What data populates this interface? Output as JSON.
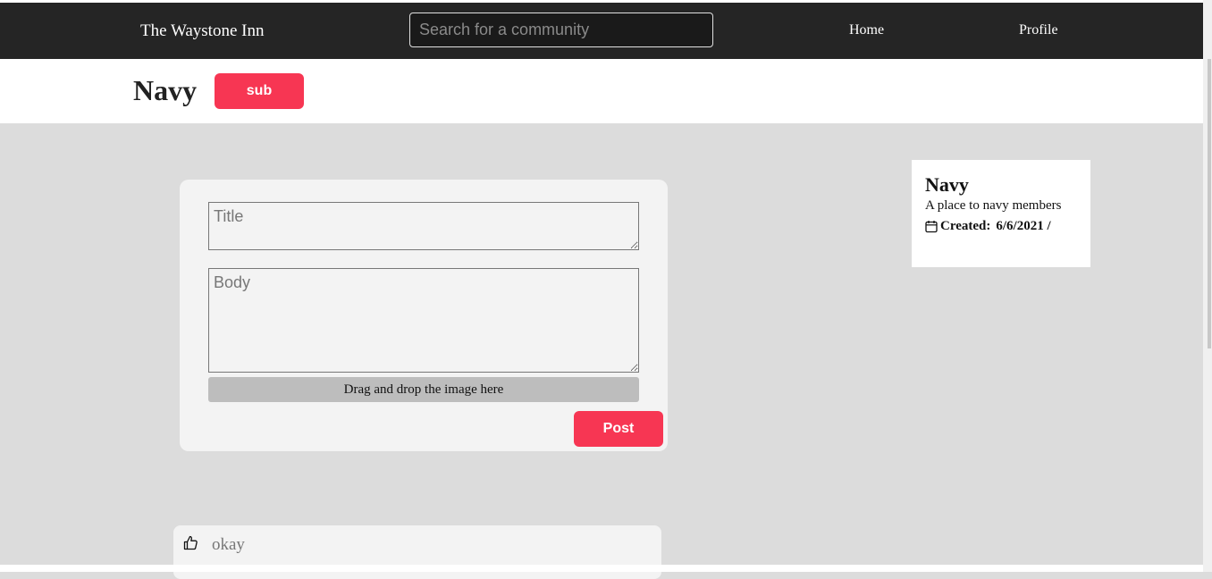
{
  "navbar": {
    "brand": "The Waystone Inn",
    "search_placeholder": "Search for a community",
    "links": [
      "Home",
      "Profile"
    ]
  },
  "community": {
    "title": "Navy",
    "subscribe_label": "sub"
  },
  "post_form": {
    "title_placeholder": "Title",
    "body_placeholder": "Body",
    "dropzone_text": "Drag and drop the image here",
    "post_label": "Post"
  },
  "sidebar": {
    "name": "Navy",
    "description": "A place to navy members",
    "created_label": "Created:",
    "created_value": "6/6/2021 /",
    "icon": "calendar-icon"
  },
  "posts": [
    {
      "title": "okay",
      "icon": "thumbs-up-icon"
    }
  ],
  "colors": {
    "navbar": "#252525",
    "accent": "#f73653",
    "background": "#dcdcdc",
    "card": "#f3f3f3"
  }
}
